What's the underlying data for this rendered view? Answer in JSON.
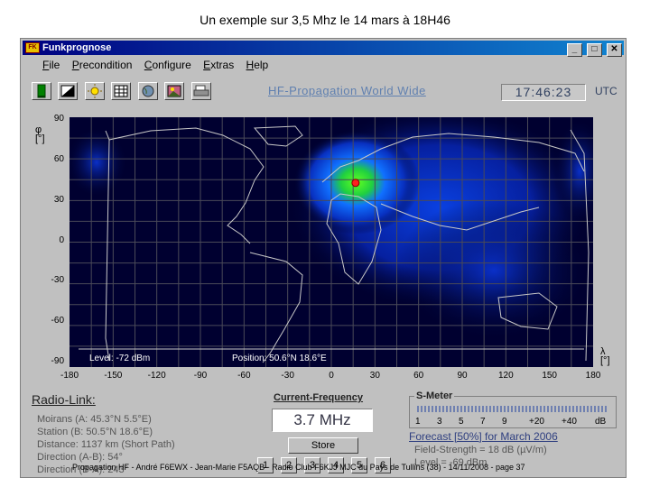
{
  "slide_title": "Un exemple sur 3,5 Mhz le 14 mars à 18H46",
  "window": {
    "title": "Funkprognose",
    "icon_label": "FK",
    "controls": [
      "_",
      "□",
      "✕"
    ]
  },
  "menu": [
    {
      "key": "F",
      "rest": "ile"
    },
    {
      "key": "P",
      "rest": "recondition"
    },
    {
      "key": "C",
      "rest": "onfigure"
    },
    {
      "key": "E",
      "rest": "xtras"
    },
    {
      "key": "H",
      "rest": "elp"
    }
  ],
  "toolbar": {
    "icons": [
      "door-icon",
      "contrast-icon",
      "sun-icon",
      "grid-icon",
      "globe-icon",
      "image-icon",
      "printer-icon"
    ]
  },
  "header": {
    "title": "HF-Propagation World Wide",
    "clock": "17:46:23",
    "timezone": "UTC"
  },
  "map": {
    "lat_label": "φ",
    "lat_unit": "[°]",
    "lon_label": "λ",
    "lon_unit": "[°]",
    "lat_ticks": [
      "90",
      "60",
      "30",
      "0",
      "-30",
      "-60",
      "-90"
    ],
    "lon_ticks": [
      "-180",
      "-150",
      "-120",
      "-90",
      "-60",
      "-30",
      "0",
      "30",
      "60",
      "90",
      "120",
      "150",
      "180"
    ],
    "level_readout": "Level: -72 dBm",
    "position_readout": "Position:  50.6°N  18.6°E",
    "transmitter": {
      "lat": 45.3,
      "lon": 5.5
    }
  },
  "radio_link": {
    "title": "Radio-Link:",
    "lines": [
      "Moirans (A: 45.3°N 5.5°E)",
      "Station (B: 50.5°N 18.6°E)",
      "Distance: 1137 km (Short Path)",
      "Direction (A-B): 54°",
      "Direction (B-A): 243°"
    ]
  },
  "current_frequency": {
    "title": "Current-Frequency",
    "value": "3.7 MHz",
    "store_label": "Store",
    "presets": [
      "1",
      "2",
      "3",
      "4",
      "5",
      "6"
    ]
  },
  "s_meter": {
    "title": "S-Meter",
    "scale": [
      "1",
      "3",
      "5",
      "7",
      "9",
      "+20",
      "+40",
      "dB"
    ]
  },
  "forecast": {
    "title": "Forecast [50%] for March 2006",
    "field_strength": "Field-Strength = 18 dB (µV/m)",
    "level": "Level = -69 dBm"
  },
  "footer": "Propagation HF - André F6EWX - Jean-Marie F5AQB - Radio Club F6KJJ MJC du Pays de Tullins (38) - 14/11/2008 - page 37"
}
